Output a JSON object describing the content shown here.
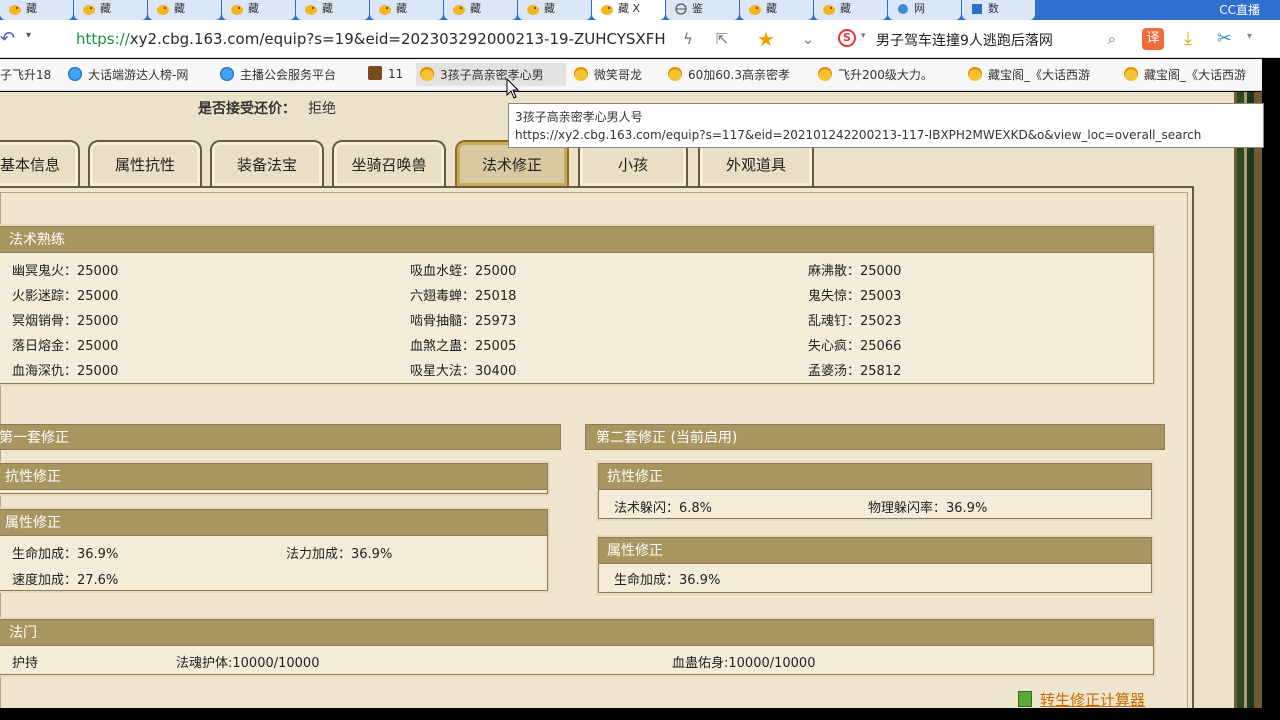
{
  "browser": {
    "tabs": [
      {
        "label": "藏"
      },
      {
        "label": "藏"
      },
      {
        "label": "藏"
      },
      {
        "label": "藏"
      },
      {
        "label": "藏"
      },
      {
        "label": "藏"
      },
      {
        "label": "藏"
      },
      {
        "label": "藏"
      },
      {
        "label": "藏 X"
      },
      {
        "label": "鉴"
      },
      {
        "label": "藏"
      },
      {
        "label": "藏"
      },
      {
        "label": "网"
      },
      {
        "label": "数"
      }
    ],
    "live_label": "CC直播",
    "url_scheme": "https://",
    "url_rest": "xy2.cbg.163.com/equip?s=19&eid=202303292000213-19-ZUHCYSXFH",
    "search_engine_icon": "S",
    "search_text": "男子驾车连撞9人逃跑后落网",
    "translate_label": "译"
  },
  "bookmarks": [
    {
      "label": "子飞升18"
    },
    {
      "label": "大话端游达人榜-网"
    },
    {
      "label": "主播公会服务平台"
    },
    {
      "label": "11"
    },
    {
      "label": "3孩子高亲密孝心男"
    },
    {
      "label": "微笑哥龙"
    },
    {
      "label": "60加60.3高亲密孝"
    },
    {
      "label": "飞升200级大力。"
    },
    {
      "label": "藏宝阁_《大话西游"
    },
    {
      "label": "藏宝阁_《大话西游"
    }
  ],
  "tooltip": {
    "title": "3孩子高亲密孝心男人号",
    "url": "https://xy2.cbg.163.com/equip?s=117&eid=202101242200213-117-IBXPH2MWEXKD&o&view_loc=overall_search"
  },
  "page": {
    "accept_label": "是否接受还价：",
    "accept_value": "拒绝",
    "tabs": [
      "基本信息",
      "属性抗性",
      "装备法宝",
      "坐骑召唤兽",
      "法术修正",
      "小孩",
      "外观道具"
    ],
    "skill_section": {
      "title": "法术熟练",
      "rows": [
        [
          "幽冥鬼火：25000",
          "吸血水蛭：25000",
          "麻沸散：25000"
        ],
        [
          "火影迷踪：25000",
          "六翅毒蝉：25018",
          "鬼失惊：25003"
        ],
        [
          "冥烟销骨：25000",
          "啮骨抽髓：25973",
          "乱魂钉：25023"
        ],
        [
          "落日熔金：25000",
          "血煞之蛊：25005",
          "失心疯：25066"
        ],
        [
          "血海深仇：25000",
          "吸星大法：30400",
          "孟婆汤：25812"
        ]
      ]
    },
    "set1": {
      "title": "第一套修正",
      "resist_title": "抗性修正",
      "attr_title": "属性修正",
      "attr_items": [
        "生命加成：36.9%",
        "法力加成：36.9%",
        "速度加成：27.6%"
      ]
    },
    "set2": {
      "title": "第二套修正 (当前启用)",
      "resist_title": "抗性修正",
      "resist_items": [
        "法术躲闪：6.8%",
        "物理躲闪率：36.9%"
      ],
      "attr_title": "属性修正",
      "attr_items": [
        "生命加成：36.9%"
      ]
    },
    "fa_men": {
      "title": "法门",
      "items": [
        "护持",
        "法魂护体:10000/10000",
        "血蛊佑身:10000/10000"
      ]
    },
    "calculator_link": "转生修正计算器"
  }
}
